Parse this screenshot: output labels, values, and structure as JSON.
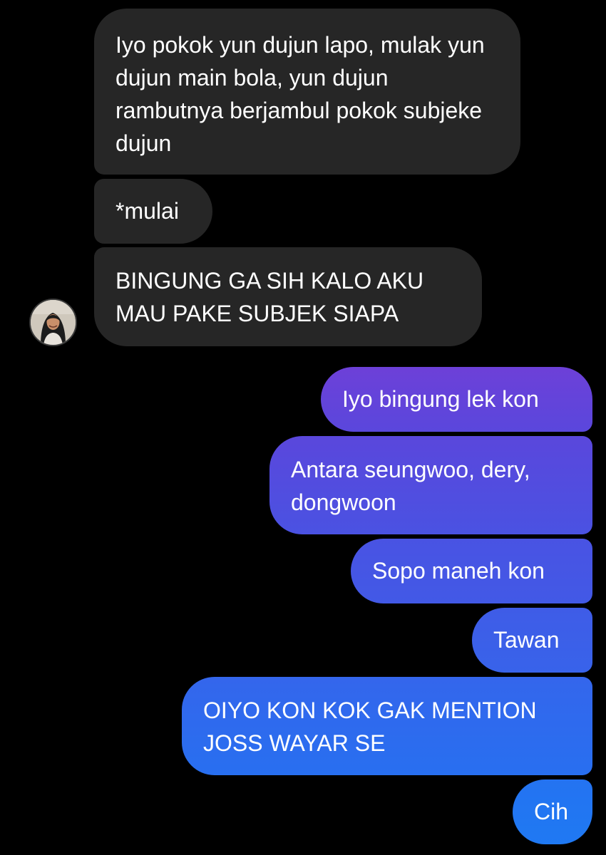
{
  "conversation": {
    "incoming": [
      {
        "text": "Iyo pokok yun dujun lapo, mulak yun dujun main bola, yun dujun rambutnya berjambul pokok subjeke dujun"
      },
      {
        "text": "*mulai"
      },
      {
        "text": "BINGUNG GA SIH KALO AKU MAU PAKE SUBJEK SIAPA"
      }
    ],
    "outgoing": [
      {
        "text": "Iyo bingung lek kon"
      },
      {
        "text": "Antara seungwoo, dery, dongwoon"
      },
      {
        "text": "Sopo maneh kon"
      },
      {
        "text": "Tawan"
      },
      {
        "text": "OIYO KON KOK GAK MENTION JOSS WAYAR SE"
      },
      {
        "text": "Cih"
      }
    ]
  },
  "contact": {
    "avatar_icon": "profile-photo-avatar"
  },
  "colors": {
    "background": "#000000",
    "incoming_bubble": "#262626",
    "outgoing_gradient_top": "#6a3fd6",
    "outgoing_gradient_bottom": "#1f7cf2",
    "text": "#ffffff"
  }
}
